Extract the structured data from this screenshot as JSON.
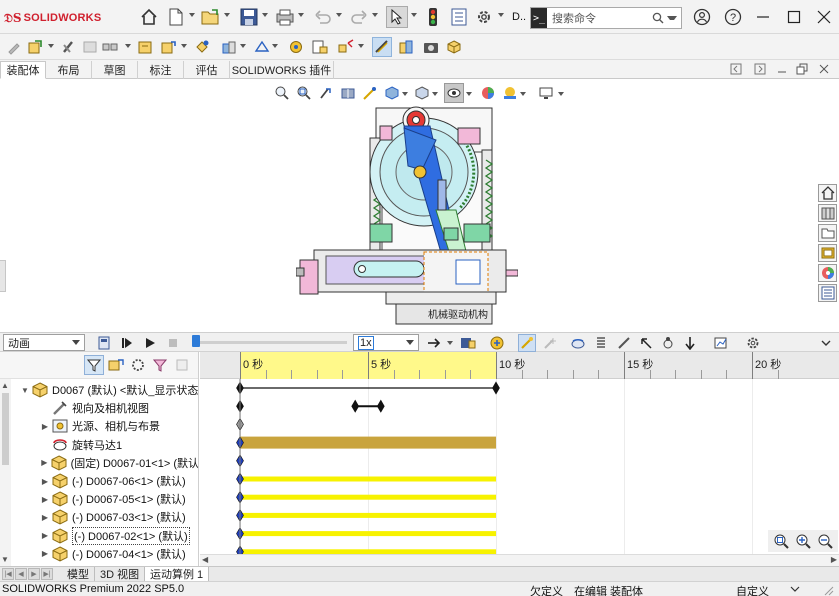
{
  "app": {
    "brand": "SOLIDWORKS",
    "document_short": "D..",
    "search_placeholder": "搜索命令"
  },
  "title_toolbar_icons": [
    "home-icon",
    "new-document-icon",
    "open-icon",
    "save-icon",
    "print-icon",
    "undo-icon",
    "redo-icon",
    "select-arrow-icon",
    "rebuild-traffic-light-icon",
    "file-properties-icon",
    "options-gear-icon"
  ],
  "window_controls": [
    "account-icon",
    "help-icon",
    "minimize-icon",
    "maximize-icon",
    "close-icon"
  ],
  "command_tabs": [
    {
      "label": "装配体",
      "active": true
    },
    {
      "label": "布局",
      "active": false
    },
    {
      "label": "草图",
      "active": false
    },
    {
      "label": "标注",
      "active": false
    },
    {
      "label": "评估",
      "active": false
    },
    {
      "label": "SOLIDWORKS 插件",
      "active": false
    }
  ],
  "graphics": {
    "model_label": "机械驱动机构"
  },
  "motion": {
    "study_type": "动画",
    "playback_speed": "1x",
    "time_ticks": [
      {
        "value": 0,
        "label": "0 秒"
      },
      {
        "value": 5,
        "label": "5 秒"
      },
      {
        "value": 10,
        "label": "10 秒"
      },
      {
        "value": 15,
        "label": "15 秒"
      },
      {
        "value": 20,
        "label": "20 秒"
      }
    ],
    "duration_seconds": 10,
    "time_max_visible": 21.5
  },
  "tree": {
    "items": [
      {
        "label": "D0067 (默认) <默认_显示状态",
        "indent": 0,
        "expander": "▼",
        "icon": "assembly-icon"
      },
      {
        "label": "视向及相机视图",
        "indent": 1,
        "expander": "",
        "icon": "camera-view-icon"
      },
      {
        "label": "光源、相机与布景",
        "indent": 1,
        "expander": "▶",
        "icon": "lights-scene-icon"
      },
      {
        "label": "旋转马达1",
        "indent": 1,
        "expander": "",
        "icon": "rotary-motor-icon"
      },
      {
        "label": "(固定) D0067-01<1> (默认",
        "indent": 1,
        "expander": "▶",
        "icon": "part-icon"
      },
      {
        "label": "(-) D0067-06<1> (默认)",
        "indent": 1,
        "expander": "▶",
        "icon": "part-icon"
      },
      {
        "label": "(-) D0067-05<1> (默认)",
        "indent": 1,
        "expander": "▶",
        "icon": "part-icon"
      },
      {
        "label": "(-) D0067-03<1> (默认)",
        "indent": 1,
        "expander": "▶",
        "icon": "part-icon"
      },
      {
        "label": "(-) D0067-02<1> (默认)",
        "indent": 1,
        "expander": "▶",
        "icon": "part-icon",
        "selected": true
      },
      {
        "label": "(-) D0067-04<1> (默认)",
        "indent": 1,
        "expander": "▶",
        "icon": "part-icon"
      }
    ]
  },
  "timeline_rows": [
    {
      "type": "duration",
      "start": 0,
      "end": 10
    },
    {
      "type": "key",
      "keys": [
        0
      ],
      "midbar": [
        4.5,
        5.5
      ]
    },
    {
      "type": "key-gray",
      "keys": [
        0
      ]
    },
    {
      "type": "motor-bar",
      "start": 0,
      "end": 10,
      "color": "#c9a43d"
    },
    {
      "type": "key",
      "keys": [
        0
      ]
    },
    {
      "type": "part-bar",
      "start": 0,
      "end": 10,
      "color": "#f7f200"
    },
    {
      "type": "part-bar",
      "start": 0,
      "end": 10,
      "color": "#f7f200"
    },
    {
      "type": "part-bar",
      "start": 0,
      "end": 10,
      "color": "#f7f200"
    },
    {
      "type": "part-bar",
      "start": 0,
      "end": 10,
      "color": "#f7f200"
    },
    {
      "type": "part-bar",
      "start": 0,
      "end": 10,
      "color": "#f7f200"
    }
  ],
  "bottom_tabs": [
    {
      "label": "模型",
      "active": false
    },
    {
      "label": "3D 视图",
      "active": false
    },
    {
      "label": "运动算例 1",
      "active": true
    }
  ],
  "status": {
    "product": "SOLIDWORKS Premium 2022 SP5.0",
    "definition": "欠定义",
    "mode": "在编辑 装配体",
    "units": "自定义"
  },
  "colors": {
    "accent_blue": "#2d7bd8",
    "brand_red": "#d0202e",
    "timeline_yellow": "#fff98a",
    "motor_bar": "#c9a43d",
    "part_bar": "#f7f200",
    "key_blue": "#1f3fbf"
  }
}
